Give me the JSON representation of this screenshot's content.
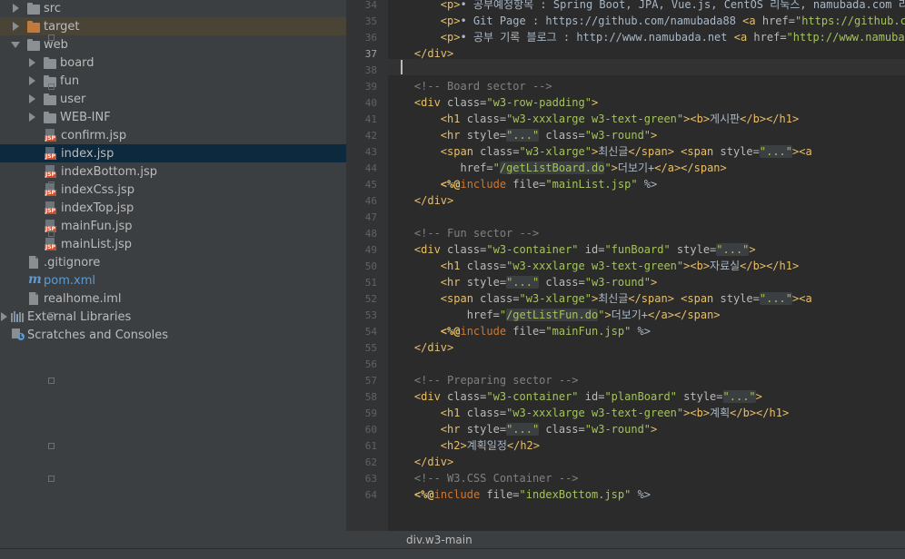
{
  "project_tree": {
    "items": [
      {
        "label": "src",
        "kind": "folder-grey",
        "indent": 0,
        "arrow": "right",
        "hl": ""
      },
      {
        "label": "target",
        "kind": "folder-orange",
        "indent": 0,
        "arrow": "right",
        "hl": "brown"
      },
      {
        "label": "web",
        "kind": "folder-grey",
        "indent": 0,
        "arrow": "down",
        "hl": ""
      },
      {
        "label": "board",
        "kind": "folder-grey",
        "indent": 1,
        "arrow": "right",
        "hl": ""
      },
      {
        "label": "fun",
        "kind": "folder-grey",
        "indent": 1,
        "arrow": "right",
        "hl": ""
      },
      {
        "label": "user",
        "kind": "folder-grey",
        "indent": 1,
        "arrow": "right",
        "hl": ""
      },
      {
        "label": "WEB-INF",
        "kind": "folder-grey",
        "indent": 1,
        "arrow": "right",
        "hl": ""
      },
      {
        "label": "confirm.jsp",
        "kind": "jsp",
        "indent": 1,
        "arrow": "",
        "hl": ""
      },
      {
        "label": "index.jsp",
        "kind": "jsp",
        "indent": 1,
        "arrow": "",
        "hl": "blue"
      },
      {
        "label": "indexBottom.jsp",
        "kind": "jsp",
        "indent": 1,
        "arrow": "",
        "hl": ""
      },
      {
        "label": "indexCss.jsp",
        "kind": "jsp",
        "indent": 1,
        "arrow": "",
        "hl": ""
      },
      {
        "label": "indexTop.jsp",
        "kind": "jsp",
        "indent": 1,
        "arrow": "",
        "hl": ""
      },
      {
        "label": "mainFun.jsp",
        "kind": "jsp",
        "indent": 1,
        "arrow": "",
        "hl": ""
      },
      {
        "label": "mainList.jsp",
        "kind": "jsp",
        "indent": 1,
        "arrow": "",
        "hl": ""
      },
      {
        "label": ".gitignore",
        "kind": "file",
        "indent": 0,
        "arrow": "",
        "hl": ""
      },
      {
        "label": "pom.xml",
        "kind": "maven",
        "indent": 0,
        "arrow": "",
        "hl": ""
      },
      {
        "label": "realhome.iml",
        "kind": "file",
        "indent": 0,
        "arrow": "",
        "hl": ""
      },
      {
        "label": "External Libraries",
        "kind": "libs",
        "indent": -1,
        "arrow": "right",
        "hl": ""
      },
      {
        "label": "Scratches and Consoles",
        "kind": "scratch",
        "indent": -1,
        "arrow": "",
        "hl": ""
      }
    ]
  },
  "editor": {
    "line_numbers": [
      "34",
      "35",
      "36",
      "37",
      "38",
      "39",
      "40",
      "41",
      "42",
      "43",
      "44",
      "45",
      "46",
      "47",
      "48",
      "49",
      "50",
      "51",
      "52",
      "53",
      "54",
      "55",
      "56",
      "57",
      "58",
      "59",
      "60",
      "61",
      "62",
      "63",
      "64"
    ],
    "lines": [
      [
        [
          "i",
          "        "
        ],
        [
          "t",
          "<p>"
        ],
        [
          "p",
          "• 공부예정항목 : Spring Boot, JPA, Vue.js, CentOS 리눅스, namubada.com 리팩"
        ]
      ],
      [
        [
          "i",
          "        "
        ],
        [
          "t",
          "<p>"
        ],
        [
          "p",
          "• Git Page : https://github.com/namubada88 "
        ],
        [
          "t",
          "<a "
        ],
        [
          "a",
          "href="
        ],
        [
          "s",
          "\"https://github.co"
        ]
      ],
      [
        [
          "i",
          "        "
        ],
        [
          "t",
          "<p>"
        ],
        [
          "p",
          "• 공부 기록 블로그 : http://www.namubada.net "
        ],
        [
          "t",
          "<a "
        ],
        [
          "a",
          "href="
        ],
        [
          "s",
          "\"http://www.namubad"
        ]
      ],
      [
        [
          "i",
          "    "
        ],
        [
          "t",
          "</div>"
        ]
      ],
      [],
      [
        [
          "i",
          "    "
        ],
        [
          "c",
          "<!-- Board sector -->"
        ]
      ],
      [
        [
          "i",
          "    "
        ],
        [
          "t",
          "<div "
        ],
        [
          "a",
          "class="
        ],
        [
          "s",
          "\"w3-row-padding\""
        ],
        [
          "t",
          ">"
        ]
      ],
      [
        [
          "i",
          "        "
        ],
        [
          "t",
          "<h1 "
        ],
        [
          "a",
          "class="
        ],
        [
          "s",
          "\"w3-xxxlarge w3-text-green\""
        ],
        [
          "t",
          "><b>"
        ],
        [
          "p",
          "게시판"
        ],
        [
          "t",
          "</b></h1>"
        ]
      ],
      [
        [
          "i",
          "        "
        ],
        [
          "t",
          "<hr "
        ],
        [
          "a",
          "style="
        ],
        [
          "sb",
          "\"...\""
        ],
        [
          "a",
          " class="
        ],
        [
          "s",
          "\"w3-round\""
        ],
        [
          "t",
          ">"
        ]
      ],
      [
        [
          "i",
          "        "
        ],
        [
          "t",
          "<span "
        ],
        [
          "a",
          "class="
        ],
        [
          "s",
          "\"w3-xlarge\""
        ],
        [
          "t",
          ">"
        ],
        [
          "p",
          "최신글"
        ],
        [
          "t",
          "</span> <span "
        ],
        [
          "a",
          "style="
        ],
        [
          "sb",
          "\"...\""
        ],
        [
          "t",
          "><a"
        ]
      ],
      [
        [
          "i",
          "           "
        ],
        [
          "a",
          "href="
        ],
        [
          "s",
          "\""
        ],
        [
          "sb",
          "/getListBoard.do"
        ],
        [
          "s",
          "\""
        ],
        [
          "t",
          ">"
        ],
        [
          "p",
          "더보기+"
        ],
        [
          "t",
          "</a></span>"
        ]
      ],
      [
        [
          "i",
          "        "
        ],
        [
          "d",
          "<%@"
        ],
        [
          "k",
          "include "
        ],
        [
          "a",
          "file="
        ],
        [
          "s",
          "\"mainList.jsp\""
        ],
        [
          "p",
          " %>"
        ]
      ],
      [
        [
          "i",
          "    "
        ],
        [
          "t",
          "</div>"
        ]
      ],
      [],
      [
        [
          "i",
          "    "
        ],
        [
          "c",
          "<!-- Fun sector -->"
        ]
      ],
      [
        [
          "i",
          "    "
        ],
        [
          "t",
          "<div "
        ],
        [
          "a",
          "class="
        ],
        [
          "s",
          "\"w3-container\""
        ],
        [
          "a",
          " id="
        ],
        [
          "s",
          "\"funBoard\""
        ],
        [
          "a",
          " style="
        ],
        [
          "sb",
          "\"...\""
        ],
        [
          "t",
          ">"
        ]
      ],
      [
        [
          "i",
          "        "
        ],
        [
          "t",
          "<h1 "
        ],
        [
          "a",
          "class="
        ],
        [
          "s",
          "\"w3-xxxlarge w3-text-green\""
        ],
        [
          "t",
          "><b>"
        ],
        [
          "p",
          "자료실"
        ],
        [
          "t",
          "</b></h1>"
        ]
      ],
      [
        [
          "i",
          "        "
        ],
        [
          "t",
          "<hr "
        ],
        [
          "a",
          "style="
        ],
        [
          "sb",
          "\"...\""
        ],
        [
          "a",
          " class="
        ],
        [
          "s",
          "\"w3-round\""
        ],
        [
          "t",
          ">"
        ]
      ],
      [
        [
          "i",
          "        "
        ],
        [
          "t",
          "<span "
        ],
        [
          "a",
          "class="
        ],
        [
          "s",
          "\"w3-xlarge\""
        ],
        [
          "t",
          ">"
        ],
        [
          "p",
          "최신글"
        ],
        [
          "t",
          "</span> <span "
        ],
        [
          "a",
          "style="
        ],
        [
          "sb",
          "\"...\""
        ],
        [
          "t",
          "><a"
        ]
      ],
      [
        [
          "i",
          "            "
        ],
        [
          "a",
          "href="
        ],
        [
          "s",
          "\""
        ],
        [
          "sb",
          "/getListFun.do"
        ],
        [
          "s",
          "\""
        ],
        [
          "t",
          ">"
        ],
        [
          "p",
          "더보기+"
        ],
        [
          "t",
          "</a></span>"
        ]
      ],
      [
        [
          "i",
          "        "
        ],
        [
          "d",
          "<%@"
        ],
        [
          "k",
          "include "
        ],
        [
          "a",
          "file="
        ],
        [
          "s",
          "\"mainFun.jsp\""
        ],
        [
          "p",
          " %>"
        ]
      ],
      [
        [
          "i",
          "    "
        ],
        [
          "t",
          "</div>"
        ]
      ],
      [],
      [
        [
          "i",
          "    "
        ],
        [
          "c",
          "<!-- Preparing sector -->"
        ]
      ],
      [
        [
          "i",
          "    "
        ],
        [
          "t",
          "<div "
        ],
        [
          "a",
          "class="
        ],
        [
          "s",
          "\"w3-container\""
        ],
        [
          "a",
          " id="
        ],
        [
          "s",
          "\"planBoard\""
        ],
        [
          "a",
          " style="
        ],
        [
          "sb",
          "\"...\""
        ],
        [
          "t",
          ">"
        ]
      ],
      [
        [
          "i",
          "        "
        ],
        [
          "t",
          "<h1 "
        ],
        [
          "a",
          "class="
        ],
        [
          "s",
          "\"w3-xxxlarge w3-text-green\""
        ],
        [
          "t",
          "><b>"
        ],
        [
          "p",
          "계획"
        ],
        [
          "t",
          "</b></h1>"
        ]
      ],
      [
        [
          "i",
          "        "
        ],
        [
          "t",
          "<hr "
        ],
        [
          "a",
          "style="
        ],
        [
          "sb",
          "\"...\""
        ],
        [
          "a",
          " class="
        ],
        [
          "s",
          "\"w3-round\""
        ],
        [
          "t",
          ">"
        ]
      ],
      [
        [
          "i",
          "        "
        ],
        [
          "t",
          "<h2>"
        ],
        [
          "p",
          "계획일정"
        ],
        [
          "t",
          "</h2>"
        ]
      ],
      [
        [
          "i",
          "    "
        ],
        [
          "t",
          "</div>"
        ]
      ],
      [
        [
          "i",
          "    "
        ],
        [
          "c",
          "<!-- W3.CSS Container -->"
        ]
      ],
      [
        [
          "i",
          "    "
        ],
        [
          "d",
          "<%@"
        ],
        [
          "k",
          "include "
        ],
        [
          "a",
          "file="
        ],
        [
          "s",
          "\"indexBottom.jsp\""
        ],
        [
          "p",
          " %>"
        ]
      ],
      []
    ]
  },
  "statusbar": {
    "breadcrumb": "div.w3-main"
  }
}
